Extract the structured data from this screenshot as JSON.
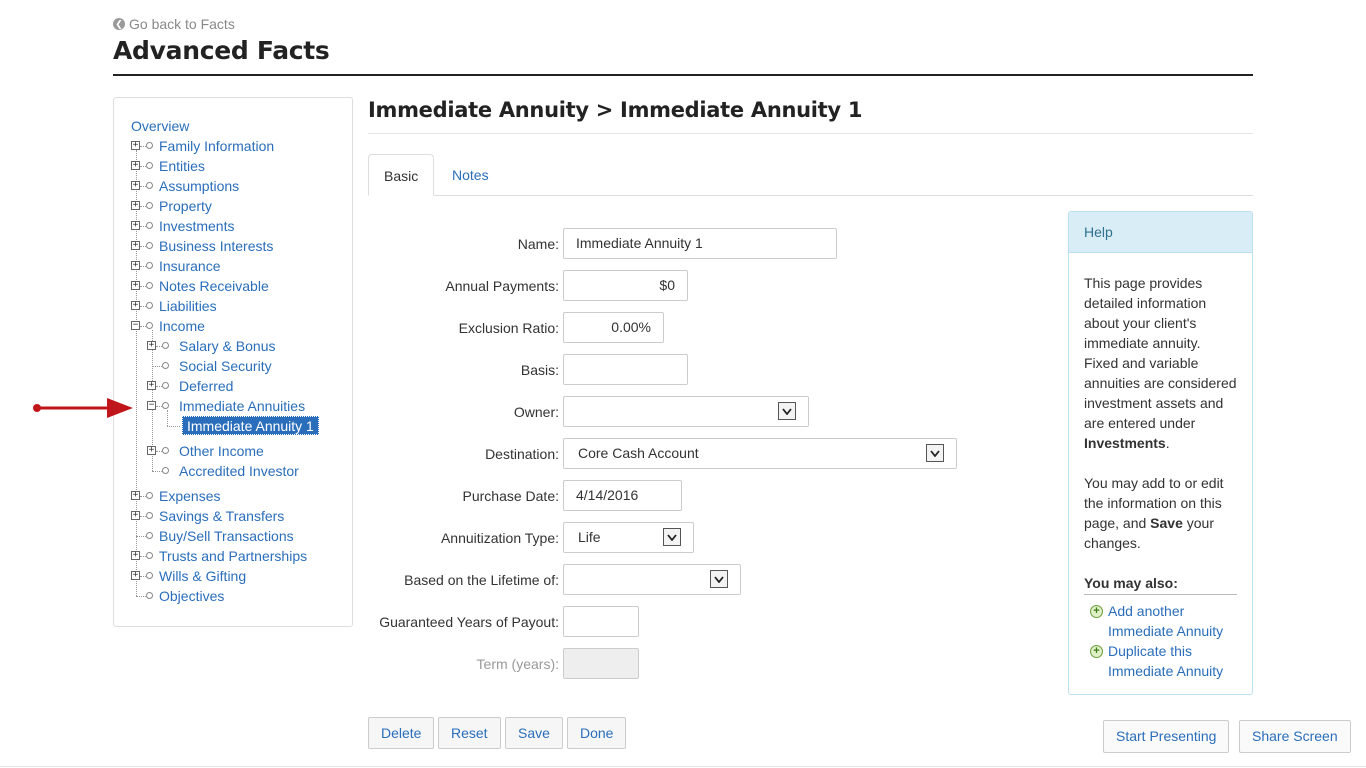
{
  "header": {
    "back_link": "Go back to Facts",
    "title": "Advanced Facts"
  },
  "sidebar": {
    "overview": "Overview",
    "items": [
      {
        "label": "Family Information"
      },
      {
        "label": "Entities"
      },
      {
        "label": "Assumptions"
      },
      {
        "label": "Property"
      },
      {
        "label": "Investments"
      },
      {
        "label": "Business Interests"
      },
      {
        "label": "Insurance"
      },
      {
        "label": "Notes Receivable"
      },
      {
        "label": "Liabilities"
      },
      {
        "label": "Income"
      },
      {
        "label": "Salary & Bonus"
      },
      {
        "label": "Social Security"
      },
      {
        "label": "Deferred"
      },
      {
        "label": "Immediate Annuities"
      },
      {
        "label": "Immediate Annuity 1"
      },
      {
        "label": "Other Income"
      },
      {
        "label": "Accredited Investor"
      },
      {
        "label": "Expenses"
      },
      {
        "label": "Savings & Transfers"
      },
      {
        "label": "Buy/Sell Transactions"
      },
      {
        "label": "Trusts and Partnerships"
      },
      {
        "label": "Wills & Gifting"
      },
      {
        "label": "Objectives"
      }
    ]
  },
  "main": {
    "heading": "Immediate Annuity > Immediate Annuity 1",
    "tabs": [
      {
        "label": "Basic",
        "active": true
      },
      {
        "label": "Notes",
        "active": false
      }
    ],
    "form": {
      "name": {
        "label": "Name:",
        "value": "Immediate Annuity 1"
      },
      "annual_payments": {
        "label": "Annual Payments:",
        "value": "$0"
      },
      "exclusion_ratio": {
        "label": "Exclusion Ratio:",
        "value": "0.00%"
      },
      "basis": {
        "label": "Basis:",
        "value": ""
      },
      "owner": {
        "label": "Owner:",
        "value": ""
      },
      "destination": {
        "label": "Destination:",
        "value": "Core Cash Account"
      },
      "purchase_date": {
        "label": "Purchase Date:",
        "value": "4/14/2016"
      },
      "annuitization_type": {
        "label": "Annuitization Type:",
        "value": "Life"
      },
      "lifetime_of": {
        "label": "Based on the Lifetime of:",
        "value": ""
      },
      "guaranteed_years": {
        "label": "Guaranteed Years of Payout:",
        "value": ""
      },
      "term_years": {
        "label": "Term (years):",
        "value": ""
      }
    },
    "buttons": {
      "delete": "Delete",
      "reset": "Reset",
      "save": "Save",
      "done": "Done"
    }
  },
  "help": {
    "title": "Help",
    "p1_a": "This page provides detailed information about your client's immediate annuity. Fixed and variable annuities are considered investment assets and are entered under ",
    "p1_bold": "Investments",
    "p1_end": ".",
    "p2_a": "You may add to or edit the information on this page, and ",
    "p2_bold": "Save",
    "p2_end": " your changes.",
    "also_title": "You may also:",
    "links": [
      {
        "label": "Add another Immediate Annuity"
      },
      {
        "label": "Duplicate this Immediate Annuity"
      }
    ]
  },
  "footer": {
    "start_presenting": "Start Presenting",
    "share_screen": "Share Screen"
  },
  "colors": {
    "link": "#2a6ebb",
    "help_header_bg": "#d9edf7",
    "arrow": "#c0151b"
  },
  "icons": {
    "back": "arrow-left-circle-icon",
    "expand": "plus-box-icon",
    "collapse": "minus-box-icon",
    "dropdown": "chevron-down-icon",
    "add": "plus-circle-icon"
  }
}
